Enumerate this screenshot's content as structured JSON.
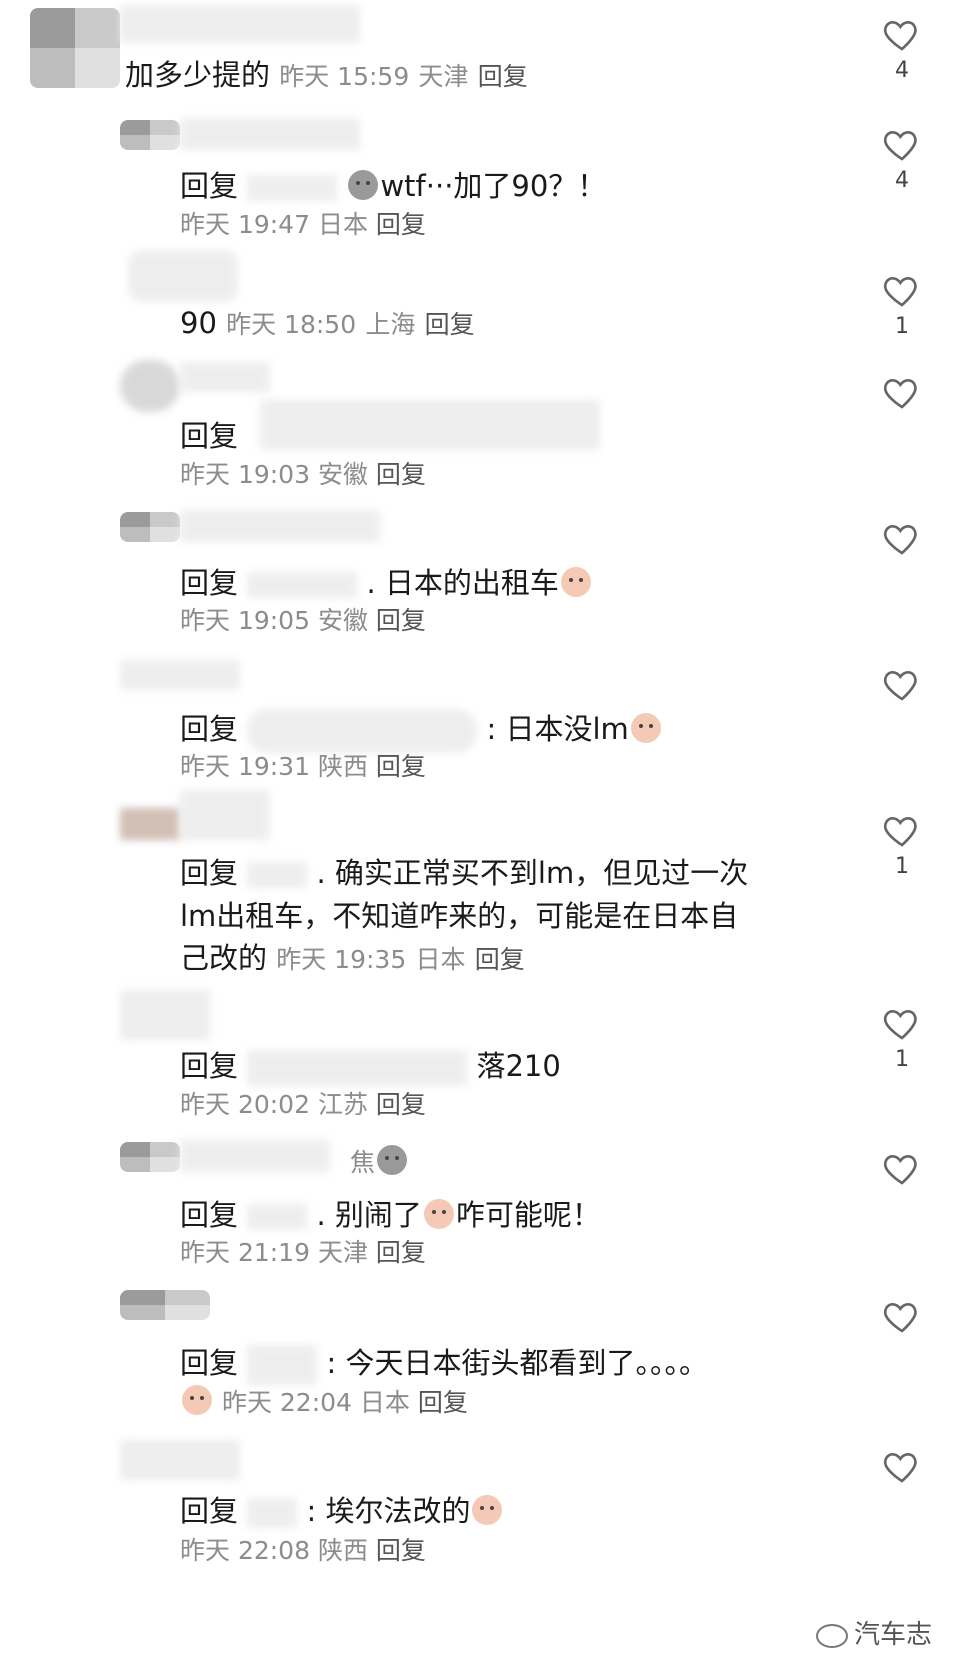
{
  "comments": [
    {
      "text": "加多少提的",
      "time": "昨天 15:59",
      "loc": "天津",
      "reply": "回复",
      "likes": "4"
    },
    {
      "prefix": "回复",
      "text": "wtf···加了90？！",
      "time": "昨天 19:47",
      "loc": "日本",
      "reply": "回复",
      "likes": "4"
    },
    {
      "text": "90",
      "time": "昨天 18:50",
      "loc": "上海",
      "reply": "回复",
      "likes": "1"
    },
    {
      "prefix": "回复",
      "text": "",
      "time": "昨天 19:03",
      "loc": "安徽",
      "reply": "回复",
      "likes": ""
    },
    {
      "prefix": "回复",
      "text": ". 日本的出租车",
      "time": "昨天 19:05",
      "loc": "安徽",
      "reply": "回复",
      "likes": ""
    },
    {
      "prefix": "回复",
      "text": ": 日本没lm",
      "time": "昨天 19:31",
      "loc": "陕西",
      "reply": "回复",
      "likes": ""
    },
    {
      "prefix": "回复",
      "text1": ". 确实正常买不到lm，但见过一次",
      "text2": "lm出租车，不知道咋来的，可能是在日本自",
      "text3": "己改的",
      "time": "昨天 19:35",
      "loc": "日本",
      "reply": "回复",
      "likes": "1"
    },
    {
      "prefix": "回复",
      "text": "落210",
      "time": "昨天 20:02",
      "loc": "江苏",
      "reply": "回复",
      "likes": "1"
    },
    {
      "name": "焦",
      "prefix": "回复",
      "text1": ". 别闹了",
      "text2": "咋可能呢！",
      "time": "昨天 21:19",
      "loc": "天津",
      "reply": "回复",
      "likes": ""
    },
    {
      "prefix": "回复",
      "text": ": 今天日本街头都看到了。。。。",
      "time": "昨天 22:04",
      "loc": "日本",
      "reply": "回复",
      "likes": ""
    },
    {
      "prefix": "回复",
      "text": ": 埃尔法改的",
      "time": "昨天 22:08",
      "loc": "陕西",
      "reply": "回复",
      "likes": ""
    }
  ],
  "watermark": "汽车志",
  "colors": {
    "meta": "#8c8c8c",
    "heart": "#666666"
  }
}
